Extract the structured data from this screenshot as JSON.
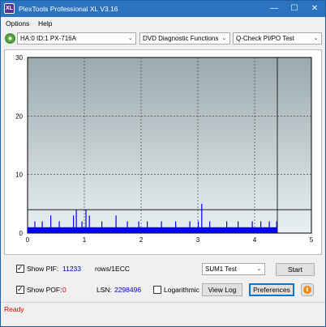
{
  "window": {
    "title": "PlexTools Professional XL V3.16",
    "icon_label": "XL"
  },
  "titlebar_buttons": {
    "minimize": "—",
    "maximize": "☐",
    "close": "✕"
  },
  "menu": {
    "options": "Options",
    "help": "Help"
  },
  "toolbar": {
    "drive": "HA:0 ID:1  PX-716A",
    "function": "DVD Diagnostic Functions",
    "test": "Q-Check PI/PO Test",
    "dropdown_arrow": "⌄"
  },
  "chart_data": {
    "type": "bar",
    "xlim": [
      0,
      5
    ],
    "ylim": [
      0,
      30
    ],
    "x_ticks": [
      "0",
      "1",
      "2",
      "3",
      "4",
      "5"
    ],
    "y_ticks": [
      "0",
      "10",
      "20",
      "30"
    ],
    "grid": true,
    "data_end_x": 4.4,
    "threshold_y": 4,
    "background": "gradient gray-blue",
    "series": [
      {
        "color": "#0000ff",
        "baseline_level": 1,
        "spikes": [
          [
            0.12,
            2
          ],
          [
            0.25,
            2
          ],
          [
            0.4,
            3
          ],
          [
            0.55,
            2
          ],
          [
            0.8,
            3
          ],
          [
            0.85,
            4
          ],
          [
            0.95,
            2
          ],
          [
            1.02,
            4
          ],
          [
            1.08,
            3
          ],
          [
            1.3,
            2
          ],
          [
            1.55,
            3
          ],
          [
            1.75,
            2
          ],
          [
            1.95,
            2
          ],
          [
            2.1,
            2
          ],
          [
            2.35,
            2
          ],
          [
            2.6,
            2
          ],
          [
            2.85,
            2
          ],
          [
            3.0,
            2
          ],
          [
            3.06,
            5
          ],
          [
            3.2,
            2
          ],
          [
            3.5,
            2
          ],
          [
            3.7,
            2
          ],
          [
            3.95,
            2
          ],
          [
            4.1,
            2
          ],
          [
            4.25,
            2
          ],
          [
            4.38,
            2
          ]
        ]
      }
    ]
  },
  "bottom": {
    "show_pif_label": "Show PIF:",
    "pif_value": "11233",
    "pif_units": "rows/1ECC",
    "show_pof_label": "Show POF:",
    "pof_value": "0",
    "lsn_label": "LSN:",
    "lsn_value": "2298496",
    "logarithmic_label": "Logarithmic",
    "sum_select": "SUM1 Test",
    "start_button": "Start",
    "view_log_button": "View Log",
    "preferences_button": "Preferences",
    "info_icon": "i"
  },
  "status": {
    "text": "Ready"
  }
}
